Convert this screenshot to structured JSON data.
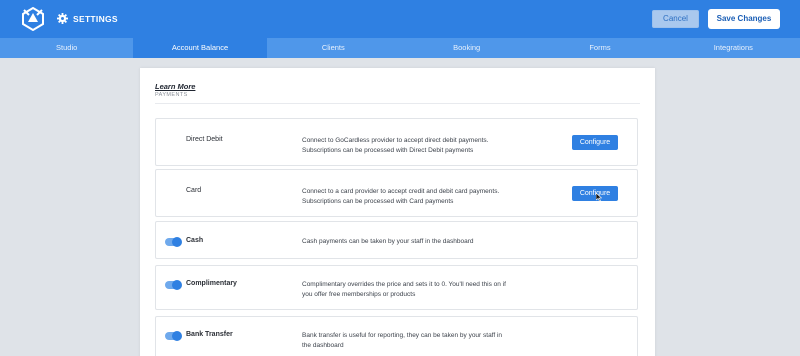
{
  "header": {
    "title": "SETTINGS",
    "cancel_label": "Cancel",
    "save_label": "Save Changes"
  },
  "tabs": [
    {
      "label": "Studio",
      "active": false
    },
    {
      "label": "Account Balance",
      "active": true
    },
    {
      "label": "Clients",
      "active": false
    },
    {
      "label": "Booking",
      "active": false
    },
    {
      "label": "Forms",
      "active": false
    },
    {
      "label": "Integrations",
      "active": false
    }
  ],
  "content": {
    "learn_more": "Learn More",
    "section_label": "PAYMENTS",
    "methods": [
      {
        "name": "Direct Debit",
        "description": "Connect to GoCardless provider to accept direct debit payments. Subscriptions can be processed with Direct Debit payments",
        "button": "Configure"
      },
      {
        "name": "Card",
        "description": "Connect to a card provider to accept credit and debit card payments. Subscriptions can be processed with Card payments",
        "button": "Configure"
      },
      {
        "name": "Cash",
        "description": "Cash payments can be taken by your staff in the dashboard",
        "toggle": true
      },
      {
        "name": "Complimentary",
        "description": "Complimentary overrides the price and sets it to 0. You'll need this on if you offer free memberships or products",
        "toggle": true
      },
      {
        "name": "Bank Transfer",
        "description": "Bank transfer is useful for reporting, they can be taken by your staff in the dashboard",
        "toggle": true
      }
    ]
  },
  "colors": {
    "primary": "#2f80e2",
    "tab_bar": "#4f97ea",
    "background": "#dfe3e8"
  },
  "icons": [
    "app-logo-icon",
    "gear-icon",
    "mouse-cursor-icon"
  ]
}
